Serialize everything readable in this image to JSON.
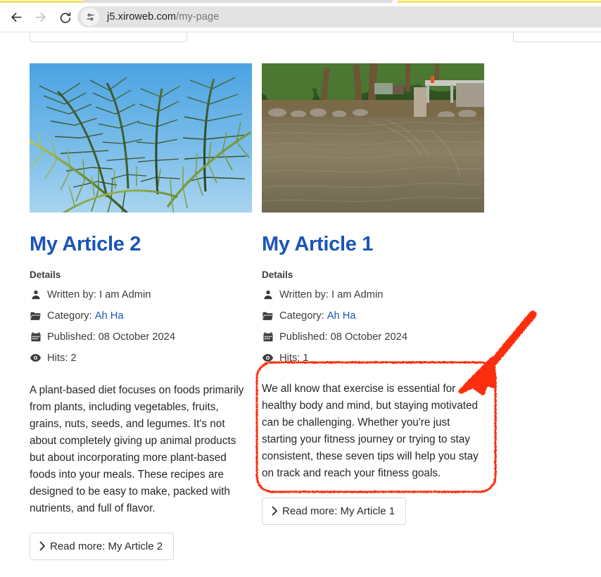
{
  "browser": {
    "back_icon": "back-arrow-icon",
    "forward_icon": "forward-arrow-icon",
    "reload_icon": "reload-icon",
    "site_settings_icon": "page-settings-icon",
    "url_host": "j5.xiroweb.com",
    "url_path": "/my-page",
    "tab_accent_color": "#fbdf5a",
    "omnibox_bg": "#e3e3e3"
  },
  "page": {
    "link_color": "#1b55b7",
    "text_color": "#262626",
    "articles": [
      {
        "id": "my-article-2",
        "image_alt": "palm-trees-blue-sky-photo",
        "title": "My Article 2",
        "details_label": "Details",
        "meta": [
          {
            "icon": "user-icon",
            "label": "Written by:",
            "value": "I am Admin",
            "is_link": false
          },
          {
            "icon": "folder-icon",
            "label": "Category:",
            "value": "Ah Ha",
            "is_link": true
          },
          {
            "icon": "calendar-icon",
            "label": "Published:",
            "value": "08 October 2024",
            "is_link": false
          },
          {
            "icon": "eye-icon",
            "label": "Hits:",
            "value": "2",
            "is_link": false
          }
        ],
        "intro": "A plant-based diet focuses on foods primarily from plants, including vegetables, fruits, grains, nuts, seeds, and legumes. It's not about completely giving up animal products but about incorporating more plant-based foods into your meals. These recipes are designed to be easy to make, packed with nutrients, and full of flavor.",
        "read_more_label": "Read more: My Article 2"
      },
      {
        "id": "my-article-1",
        "image_alt": "river-water-gate-photo",
        "title": "My Article 1",
        "details_label": "Details",
        "meta": [
          {
            "icon": "user-icon",
            "label": "Written by:",
            "value": "I am Admin",
            "is_link": false
          },
          {
            "icon": "folder-icon",
            "label": "Category:",
            "value": "Ah Ha",
            "is_link": true
          },
          {
            "icon": "calendar-icon",
            "label": "Published:",
            "value": "08 October 2024",
            "is_link": false
          },
          {
            "icon": "eye-icon",
            "label": "Hits:",
            "value": "1",
            "is_link": false
          }
        ],
        "intro": "We all know that exercise is essential for healthy body and mind, but staying motivated can be challenging. Whether you're just starting your fitness journey or trying to stay consistent, these seven tips will help you stay on track and reach your fitness goals.",
        "read_more_label": "Read more: My Article 1"
      }
    ]
  },
  "annotation": {
    "color": "#fc2d10",
    "highlight_target": "my-article-1-intro",
    "arrow_icon": "red-arrow-icon",
    "box_icon": "red-rounded-highlight-box"
  }
}
